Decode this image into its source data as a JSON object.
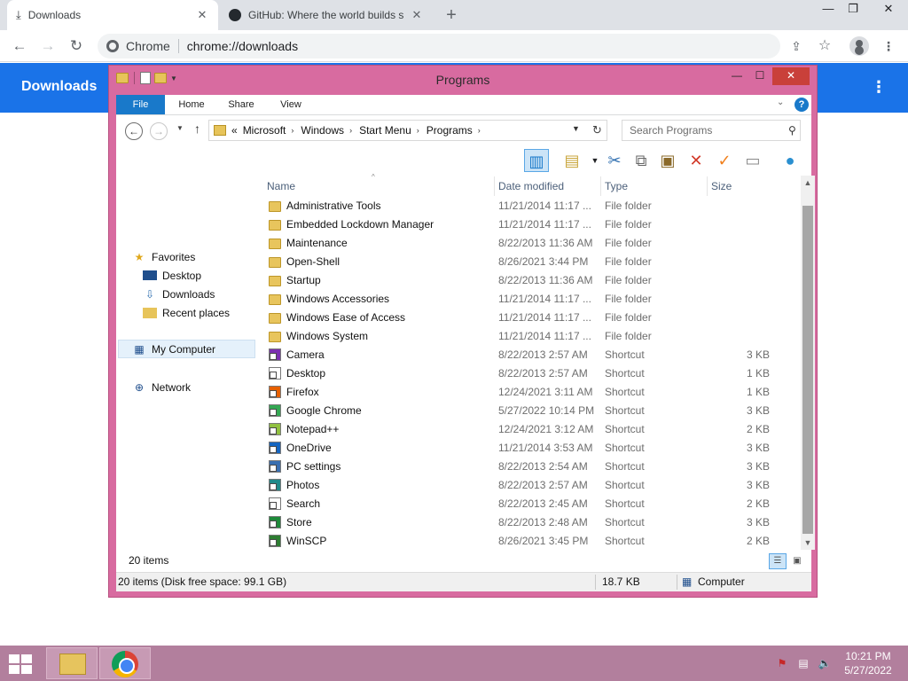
{
  "chrome": {
    "tabs": [
      {
        "title": "Downloads",
        "icon": "download-icon",
        "active": true
      },
      {
        "title": "GitHub: Where the world builds s",
        "icon": "github-icon",
        "active": false
      }
    ],
    "omnibox": {
      "chip": "Chrome",
      "url": "chrome://downloads"
    }
  },
  "downloads_page": {
    "title": "Downloads"
  },
  "explorer": {
    "title": "Programs",
    "ribbon_tabs": [
      "File",
      "Home",
      "Share",
      "View"
    ],
    "breadcrumb": {
      "prefix": "«",
      "parts": [
        "Microsoft",
        "Windows",
        "Start Menu",
        "Programs"
      ]
    },
    "search_placeholder": "Search Programs",
    "nav": {
      "favorites": "Favorites",
      "desktop": "Desktop",
      "downloads": "Downloads",
      "recent": "Recent places",
      "computer": "My Computer",
      "network": "Network"
    },
    "columns": {
      "name": "Name",
      "date": "Date modified",
      "type": "Type",
      "size": "Size"
    },
    "files": [
      {
        "name": "Administrative Tools",
        "date": "11/21/2014 11:17 ...",
        "type": "File folder",
        "size": "",
        "kind": "folder"
      },
      {
        "name": "Embedded Lockdown Manager",
        "date": "11/21/2014 11:17 ...",
        "type": "File folder",
        "size": "",
        "kind": "folder"
      },
      {
        "name": "Maintenance",
        "date": "8/22/2013 11:36 AM",
        "type": "File folder",
        "size": "",
        "kind": "folder"
      },
      {
        "name": "Open-Shell",
        "date": "8/26/2021 3:44 PM",
        "type": "File folder",
        "size": "",
        "kind": "folder"
      },
      {
        "name": "Startup",
        "date": "8/22/2013 11:36 AM",
        "type": "File folder",
        "size": "",
        "kind": "folder"
      },
      {
        "name": "Windows Accessories",
        "date": "11/21/2014 11:17 ...",
        "type": "File folder",
        "size": "",
        "kind": "folder"
      },
      {
        "name": "Windows Ease of Access",
        "date": "11/21/2014 11:17 ...",
        "type": "File folder",
        "size": "",
        "kind": "folder"
      },
      {
        "name": "Windows System",
        "date": "11/21/2014 11:17 ...",
        "type": "File folder",
        "size": "",
        "kind": "folder"
      },
      {
        "name": "Camera",
        "date": "8/22/2013 2:57 AM",
        "type": "Shortcut",
        "size": "3 KB",
        "kind": "shortcut",
        "color": "#7b2fb0"
      },
      {
        "name": "Desktop",
        "date": "8/22/2013 2:57 AM",
        "type": "Shortcut",
        "size": "1 KB",
        "kind": "shortcut",
        "color": "#ffffff"
      },
      {
        "name": "Firefox",
        "date": "12/24/2021 3:11 AM",
        "type": "Shortcut",
        "size": "1 KB",
        "kind": "shortcut",
        "color": "#e66000"
      },
      {
        "name": "Google Chrome",
        "date": "5/27/2022 10:14 PM",
        "type": "Shortcut",
        "size": "3 KB",
        "kind": "shortcut",
        "color": "#34a853"
      },
      {
        "name": "Notepad++",
        "date": "12/24/2021 3:12 AM",
        "type": "Shortcut",
        "size": "2 KB",
        "kind": "shortcut",
        "color": "#90c040"
      },
      {
        "name": "OneDrive",
        "date": "11/21/2014 3:53 AM",
        "type": "Shortcut",
        "size": "3 KB",
        "kind": "shortcut",
        "color": "#1565c0"
      },
      {
        "name": "PC settings",
        "date": "8/22/2013 2:54 AM",
        "type": "Shortcut",
        "size": "3 KB",
        "kind": "shortcut",
        "color": "#3a6fb0"
      },
      {
        "name": "Photos",
        "date": "8/22/2013 2:57 AM",
        "type": "Shortcut",
        "size": "3 KB",
        "kind": "shortcut",
        "color": "#1f8a8a"
      },
      {
        "name": "Search",
        "date": "8/22/2013 2:45 AM",
        "type": "Shortcut",
        "size": "2 KB",
        "kind": "shortcut",
        "color": "#ffffff"
      },
      {
        "name": "Store",
        "date": "8/22/2013 2:48 AM",
        "type": "Shortcut",
        "size": "3 KB",
        "kind": "shortcut",
        "color": "#1e8a3a"
      },
      {
        "name": "WinSCP",
        "date": "8/26/2021 3:45 PM",
        "type": "Shortcut",
        "size": "2 KB",
        "kind": "shortcut",
        "color": "#2e7d32"
      }
    ],
    "item_count": "20 items",
    "status": {
      "left": "20 items (Disk free space: 99.1 GB)",
      "size": "18.7 KB",
      "location": "Computer"
    }
  },
  "taskbar": {
    "time": "10:21 PM",
    "date": "5/27/2022"
  }
}
